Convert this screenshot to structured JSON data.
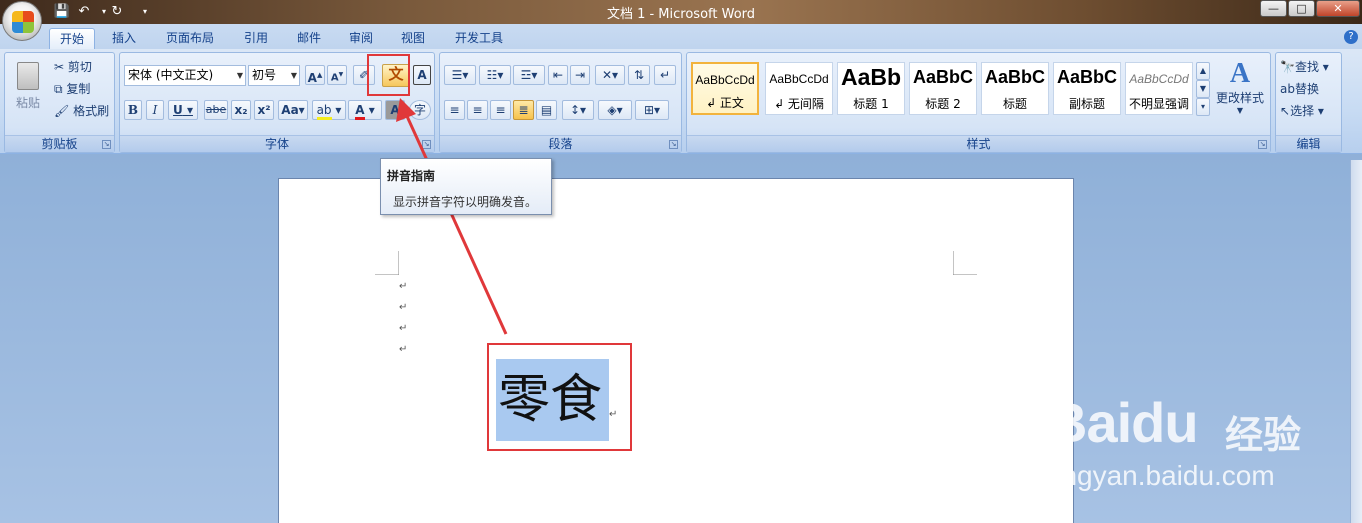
{
  "window": {
    "title": "文档 1 - Microsoft Word"
  },
  "tabs": [
    "开始",
    "插入",
    "页面布局",
    "引用",
    "邮件",
    "审阅",
    "视图",
    "开发工具"
  ],
  "clipboard": {
    "paste": "粘贴",
    "cut": "剪切",
    "copy": "复制",
    "format_painter": "格式刷",
    "label": "剪贴板"
  },
  "font": {
    "name": "宋体 (中文正文)",
    "size": "初号",
    "label": "字体",
    "grow": "A",
    "shrink": "A",
    "bold": "B",
    "italic": "I",
    "underline": "U",
    "strike": "abe",
    "subscript": "x₂",
    "superscript": "x²",
    "change_case": "Aa",
    "pinyin": "文",
    "char_border": "A",
    "char_shading": "A",
    "enclose": "字"
  },
  "paragraph": {
    "label": "段落"
  },
  "styles": {
    "label": "样式",
    "items": [
      {
        "sample": "AaBbCcDd",
        "name": "↲ 正文"
      },
      {
        "sample": "AaBbCcDd",
        "name": "↲ 无间隔"
      },
      {
        "sample": "AaBb",
        "name": "标题 1"
      },
      {
        "sample": "AaBbC",
        "name": "标题 2"
      },
      {
        "sample": "AaBbC",
        "name": "标题"
      },
      {
        "sample": "AaBbC",
        "name": "副标题"
      },
      {
        "sample": "AaBbCcDd",
        "name": "不明显强调"
      }
    ],
    "change": "更改样式"
  },
  "editing": {
    "label": "编辑",
    "find": "查找",
    "replace": "替换",
    "select": "选择"
  },
  "tooltip": {
    "title": "拼音指南",
    "desc": "显示拼音字符以明确发音。"
  },
  "document": {
    "selected_text": "零食"
  },
  "watermark": {
    "brand": "Baidu",
    "cn": "经验",
    "url": "jingyan.baidu.com"
  },
  "colors": {
    "accent_red": "#e0383a",
    "selection": "#a9c9f0",
    "ribbon": "#d6e4f6"
  }
}
